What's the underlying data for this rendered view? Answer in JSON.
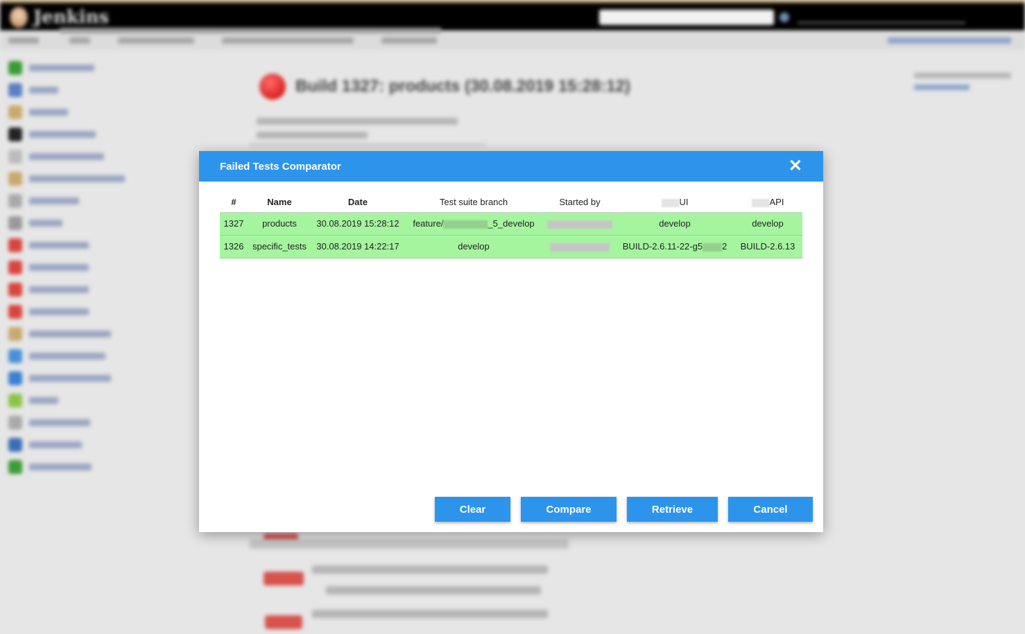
{
  "page": {
    "logo_text": "Jenkins",
    "build_title": "Build 1327: products (30.08.2019 15:28:12)",
    "sidebar_count": 19
  },
  "modal": {
    "title": "Failed Tests Comparator",
    "close_icon": "close-icon",
    "columns": {
      "num": "#",
      "name": "Name",
      "date": "Date",
      "branch": "Test suite branch",
      "started_by": "Started by",
      "ui": "UI",
      "api": "API"
    },
    "rows": [
      {
        "num": "1327",
        "name": "products",
        "date": "30.08.2019 15:28:12",
        "branch_prefix": "feature/",
        "branch_suffix": "_5_develop",
        "ui": "develop",
        "api": "develop"
      },
      {
        "num": "1326",
        "name": "specific_tests",
        "date": "30.08.2019 14:22:17",
        "branch": "develop",
        "ui_prefix": "BUILD-2.6.11-22-g5",
        "ui_suffix": "2",
        "api": "BUILD-2.6.13"
      }
    ],
    "buttons": {
      "clear": "Clear",
      "compare": "Compare",
      "retrieve": "Retrieve",
      "cancel": "Cancel"
    },
    "colors": {
      "header": "#2d94eb",
      "row": "#a5f59f",
      "button": "#2d94eb"
    }
  }
}
